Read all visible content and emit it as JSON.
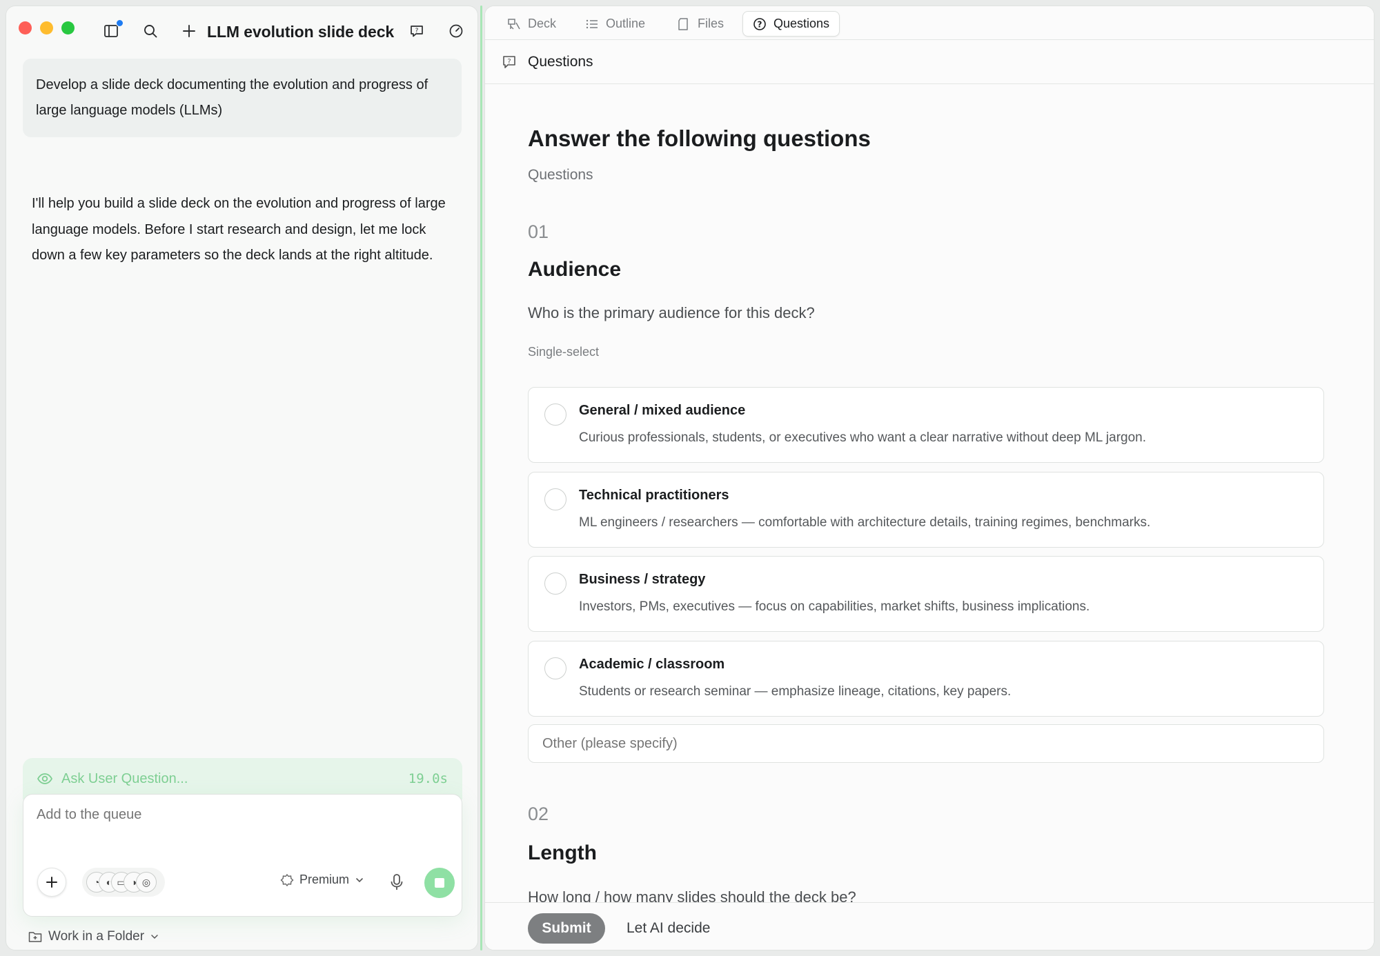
{
  "window": {
    "title": "LLM evolution slide deck"
  },
  "chat": {
    "user_message": "Develop a slide deck documenting the evolution and progress of large language models (LLMs)",
    "assistant_message": "I'll help you build a slide deck on the evolution and progress of large language models. Before I start research and design, let me lock down a few key parameters so the deck lands at the right altitude.",
    "status": {
      "label": "Ask User Question...",
      "elapsed": "19.0s"
    },
    "composer": {
      "placeholder": "Add to the queue",
      "model": "Premium"
    },
    "folder_label": "Work in a Folder"
  },
  "tabs": [
    {
      "label": "Deck",
      "icon": "deck-icon",
      "active": false
    },
    {
      "label": "Outline",
      "icon": "list-icon",
      "active": false
    },
    {
      "label": "Files",
      "icon": "file-icon",
      "active": false
    },
    {
      "label": "Questions",
      "icon": "question-circle-icon",
      "active": true
    }
  ],
  "panel": {
    "header": "Questions",
    "title": "Answer the following questions",
    "subtitle": "Questions",
    "questions": [
      {
        "number": "01",
        "title": "Audience",
        "prompt": "Who is the primary audience for this deck?",
        "mode": "Single-select",
        "options": [
          {
            "title": "General / mixed audience",
            "desc": "Curious professionals, students, or executives who want a clear narrative without deep ML jargon."
          },
          {
            "title": "Technical practitioners",
            "desc": "ML engineers / researchers — comfortable with architecture details, training regimes, benchmarks."
          },
          {
            "title": "Business / strategy",
            "desc": "Investors, PMs, executives — focus on capabilities, market shifts, business implications."
          },
          {
            "title": "Academic / classroom",
            "desc": "Students or research seminar — emphasize lineage, citations, key papers."
          }
        ],
        "other_placeholder": "Other (please specify)"
      },
      {
        "number": "02",
        "title": "Length",
        "prompt": "How long / how many slides should the deck be?"
      }
    ],
    "submit_label": "Submit",
    "ai_decide_label": "Let AI decide"
  },
  "colors": {
    "accent_green": "#8fe0a4",
    "status_green": "#7ecf93",
    "notification_blue": "#1e7cf2"
  }
}
